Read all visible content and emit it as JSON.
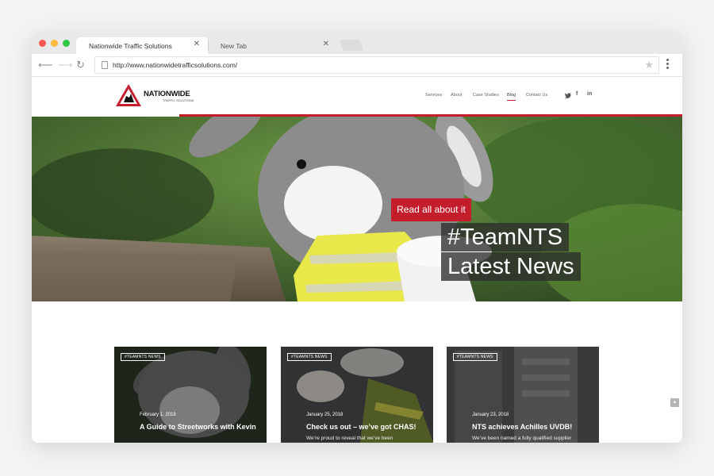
{
  "browser": {
    "tabs": [
      {
        "label": "Nationwide Traffic Solutions",
        "active": true
      },
      {
        "label": "New Tab",
        "active": false
      }
    ],
    "url": "http://www.nationwidetrafficsolutions.com/"
  },
  "site": {
    "logo": {
      "name": "NATIONWIDE",
      "sub": "TRAFFIC SOLUTIONS"
    },
    "nav": [
      "Services",
      "About",
      "Case Studies",
      "Blog",
      "Contact Us"
    ],
    "active_nav": "Blog",
    "social": [
      "twitter-icon",
      "facebook-icon",
      "linkedin-icon"
    ],
    "accent": "#c41e2d"
  },
  "hero": {
    "cta": "Read all about it",
    "headline_1": "#TeamNTS",
    "headline_2": "Latest News"
  },
  "posts": [
    {
      "tag": "#TEAMNTS NEWS",
      "date": "February 1, 2018",
      "title": "A Guide to Streetworks with Kevin",
      "excerpt": ""
    },
    {
      "tag": "#TEAMNTS NEWS",
      "date": "January 25, 2018",
      "title": "Check us out – we’ve got CHAS!",
      "excerpt": "We’re proud to reveal that we’ve been"
    },
    {
      "tag": "#TEAMNTS NEWS",
      "date": "January 23, 2018",
      "title": "NTS achieves Achilles UVDB!",
      "excerpt": "We’ve been named a fully qualified supplier"
    }
  ]
}
